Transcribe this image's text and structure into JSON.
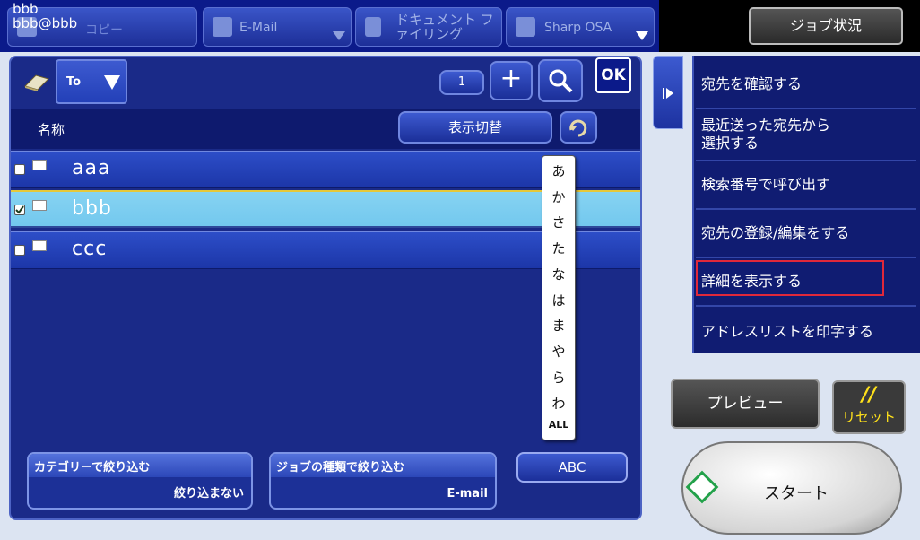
{
  "header": {
    "sender_name": "bbb",
    "sender_email": "bbb@bbb",
    "tabs": [
      {
        "label": "コピー"
      },
      {
        "label": "E-Mail"
      },
      {
        "label": "ドキュメント ファイリング"
      },
      {
        "label": "Sharp OSA"
      }
    ],
    "job_status_label": "ジョブ状況"
  },
  "address_panel": {
    "type_selector": "To",
    "page_counter": "1",
    "ok_label": "OK",
    "column_name": "名称",
    "display_switch_label": "表示切替",
    "entries": [
      {
        "name": "aaa",
        "checked": false
      },
      {
        "name": "bbb",
        "checked": true
      },
      {
        "name": "ccc",
        "checked": false
      }
    ],
    "kana_index": [
      "あ",
      "か",
      "さ",
      "た",
      "な",
      "は",
      "ま",
      "や",
      "ら",
      "わ",
      "ALL"
    ],
    "category_filter": {
      "title": "カテゴリーで絞り込む",
      "value": "絞り込まない"
    },
    "job_filter": {
      "title": "ジョブの種類で絞り込む",
      "value": "E-mail"
    },
    "abc_label": "ABC"
  },
  "side_menu": {
    "items": [
      "宛先を確認する",
      "最近送った宛先から選択する",
      "検索番号で呼び出す",
      "宛先の登録/編集をする",
      "詳細を表示する",
      "アドレスリストを印字する"
    ],
    "item_1_line1": "最近送った宛先から",
    "item_1_line2": "選択する",
    "highlighted_item": "詳細を表示する"
  },
  "actions": {
    "preview_label": "プレビュー",
    "reset_icon": "//",
    "reset_label": "リセット",
    "start_label": "スタート"
  },
  "colors": {
    "highlight_border": "#e0283a",
    "start_icon": "#23a14a",
    "reset_text": "#ffe11a"
  }
}
